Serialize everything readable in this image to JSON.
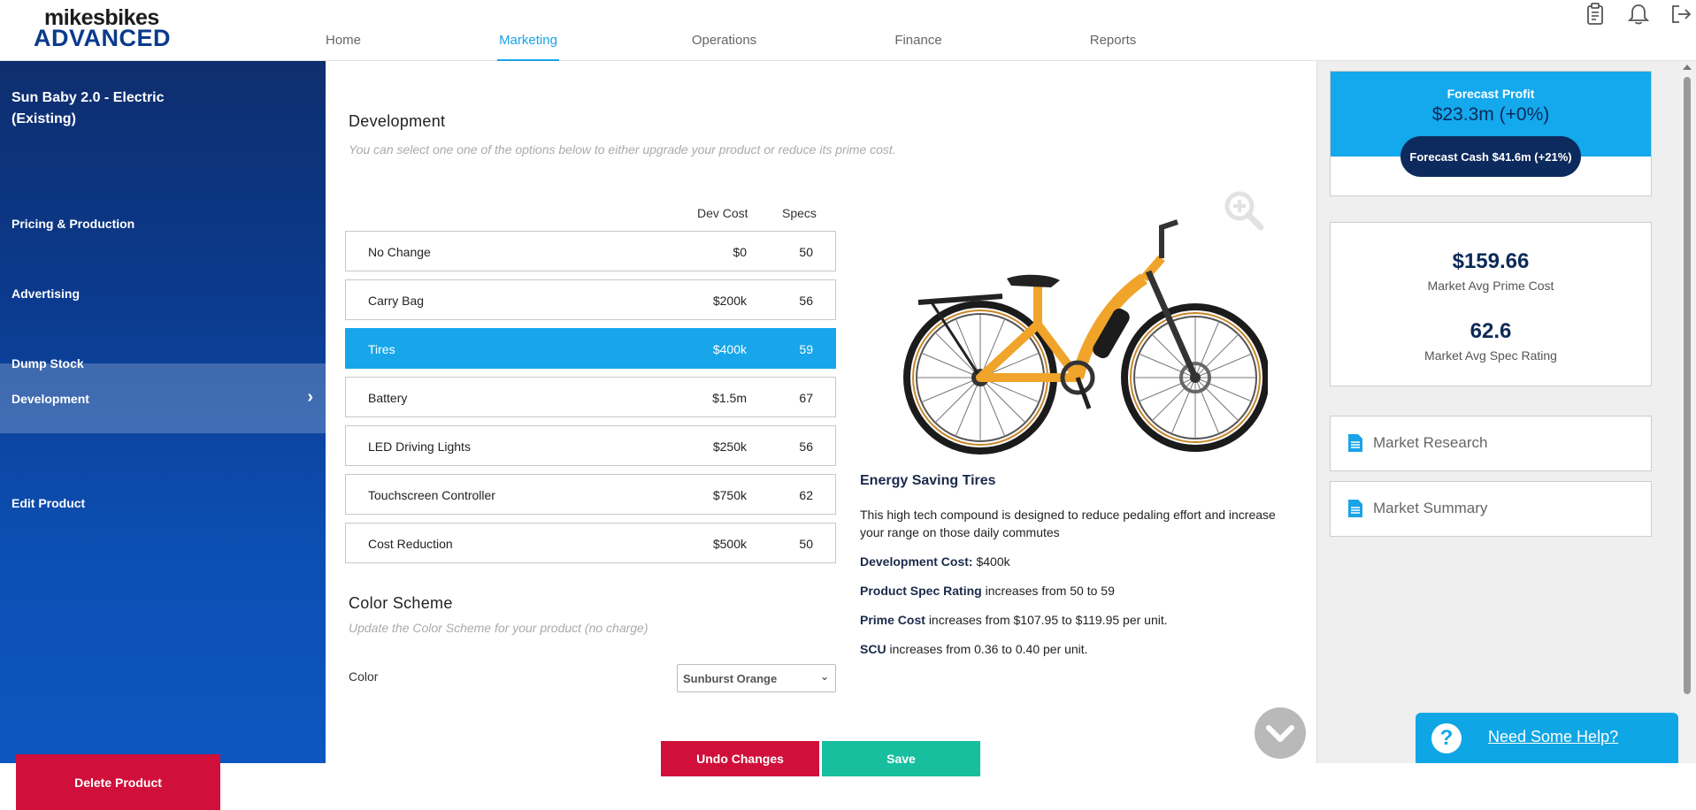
{
  "logo": {
    "top": "mikesbikes",
    "bottom": "ADVANCED"
  },
  "nav": {
    "home": "Home",
    "marketing": "Marketing",
    "operations": "Operations",
    "finance": "Finance",
    "reports": "Reports",
    "active": "Marketing"
  },
  "header_icons": [
    "clipboard-icon",
    "bell-icon",
    "logout-icon"
  ],
  "sidebar": {
    "product_title": "Sun Baby 2.0 - Electric (Existing)",
    "items": [
      {
        "label": "Pricing & Production"
      },
      {
        "label": "Advertising"
      },
      {
        "label": "Dump Stock"
      },
      {
        "label": "Development",
        "active": true
      },
      {
        "label": "Edit Product"
      }
    ],
    "delete_label": "Delete Product"
  },
  "development": {
    "heading": "Development",
    "subheading": "You can select one one of the options below to either upgrade your product or reduce its prime cost.",
    "col_cost": "Dev Cost",
    "col_specs": "Specs",
    "options": [
      {
        "name": "No Change",
        "cost": "$0",
        "specs": "50"
      },
      {
        "name": "Carry Bag",
        "cost": "$200k",
        "specs": "56"
      },
      {
        "name": "Tires",
        "cost": "$400k",
        "specs": "59",
        "selected": true
      },
      {
        "name": "Battery",
        "cost": "$1.5m",
        "specs": "67"
      },
      {
        "name": "LED Driving Lights",
        "cost": "$250k",
        "specs": "56"
      },
      {
        "name": "Touchscreen Controller",
        "cost": "$750k",
        "specs": "62"
      },
      {
        "name": "Cost Reduction",
        "cost": "$500k",
        "specs": "50"
      }
    ]
  },
  "color_scheme": {
    "heading": "Color Scheme",
    "subheading": "Update the Color Scheme for your product (no charge)",
    "label": "Color",
    "selected": "Sunburst Orange"
  },
  "detail": {
    "title": "Energy Saving Tires",
    "description": "This high tech compound is designed to reduce pedaling effort and increase your range on those daily commutes",
    "dev_cost_label": "Development Cost:",
    "dev_cost_value": "$400k",
    "spec_label": "Product Spec Rating",
    "spec_text": "increases from 50 to 59",
    "prime_label": "Prime Cost",
    "prime_text": "increases from $107.95 to $119.95 per unit.",
    "scu_label": "SCU",
    "scu_text": "increases from 0.36 to 0.40 per unit."
  },
  "actions": {
    "undo": "Undo Changes",
    "save": "Save"
  },
  "forecast": {
    "label": "Forecast Profit",
    "value": "$23.3m (+0%)",
    "cash": "Forecast Cash $41.6m (+21%)"
  },
  "market": {
    "prime_value": "$159.66",
    "prime_label": "Market Avg Prime Cost",
    "spec_value": "62.6",
    "spec_label": "Market Avg Spec Rating"
  },
  "links": {
    "research": "Market Research",
    "summary": "Market Summary"
  },
  "help": {
    "label": "Need Some Help?",
    "icon": "?"
  },
  "colors": {
    "accent": "#17a6ea",
    "navy": "#0c2a58",
    "danger": "#d0103a",
    "success": "#17bf9e"
  }
}
